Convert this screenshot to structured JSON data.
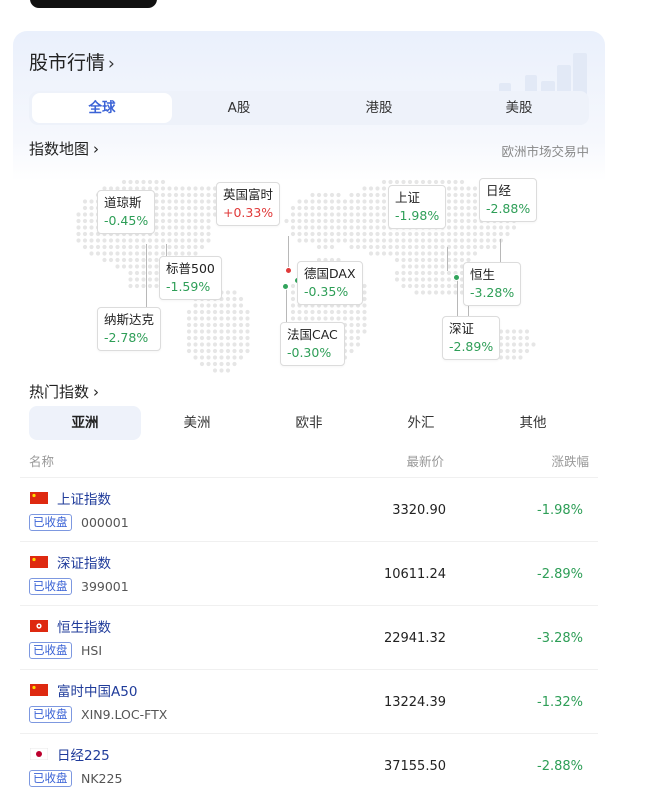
{
  "card": {
    "title": "股市行情",
    "market_tabs": [
      "全球",
      "A股",
      "港股",
      "美股"
    ],
    "active_market_tab": 0
  },
  "index_map": {
    "title": "指数地图",
    "status": "欧洲市场交易中",
    "markers": [
      {
        "name": "道琼斯",
        "change": "-0.45%",
        "direction": "down"
      },
      {
        "name": "纳斯达克",
        "change": "-2.78%",
        "direction": "down"
      },
      {
        "name": "标普500",
        "change": "-1.59%",
        "direction": "down"
      },
      {
        "name": "英国富时",
        "change": "+0.33%",
        "direction": "up"
      },
      {
        "name": "德国DAX",
        "change": "-0.35%",
        "direction": "down"
      },
      {
        "name": "法国CAC",
        "change": "-0.30%",
        "direction": "down"
      },
      {
        "name": "上证",
        "change": "-1.98%",
        "direction": "down"
      },
      {
        "name": "日经",
        "change": "-2.88%",
        "direction": "down"
      },
      {
        "name": "恒生",
        "change": "-3.28%",
        "direction": "down"
      },
      {
        "name": "深证",
        "change": "-2.89%",
        "direction": "down"
      }
    ],
    "colors": {
      "down": "#2e9e57",
      "up": "#e03a3a"
    }
  },
  "hot": {
    "title": "热门指数",
    "region_tabs": [
      "亚洲",
      "美洲",
      "欧非",
      "外汇",
      "其他"
    ],
    "active_region_tab": 0,
    "columns": {
      "name": "名称",
      "price": "最新价",
      "change": "涨跌幅"
    },
    "rows": [
      {
        "flag": "china-flag-icon",
        "name": "上证指数",
        "badge": "已收盘",
        "code": "000001",
        "price": "3320.90",
        "change": "-1.98%"
      },
      {
        "flag": "china-flag-icon",
        "name": "深证指数",
        "badge": "已收盘",
        "code": "399001",
        "price": "10611.24",
        "change": "-2.89%"
      },
      {
        "flag": "hongkong-flag-icon",
        "name": "恒生指数",
        "badge": "已收盘",
        "code": "HSI",
        "price": "22941.32",
        "change": "-3.28%"
      },
      {
        "flag": "china-flag-icon",
        "name": "富时中国A50",
        "badge": "已收盘",
        "code": "XIN9.LOC-FTX",
        "price": "13224.39",
        "change": "-1.32%"
      },
      {
        "flag": "japan-flag-icon",
        "name": "日经225",
        "badge": "已收盘",
        "code": "NK225",
        "price": "37155.50",
        "change": "-2.88%"
      }
    ]
  }
}
